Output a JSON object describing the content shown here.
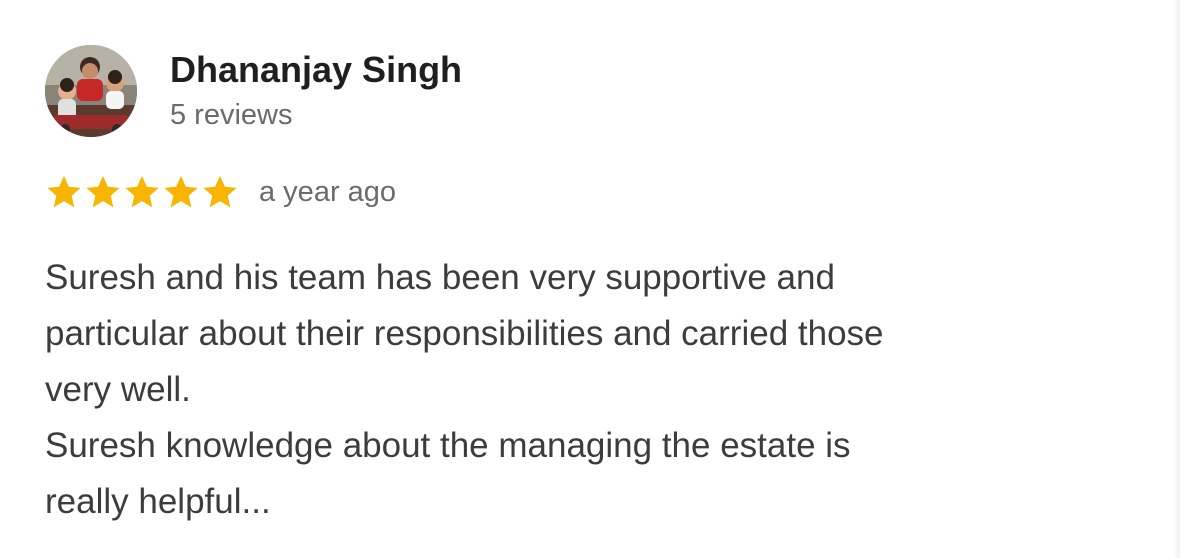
{
  "review": {
    "author": {
      "name": "Dhananjay Singh",
      "review_count": "5 reviews",
      "avatar_icon": "profile-photo"
    },
    "rating": {
      "stars": 5,
      "max": 5,
      "star_color": "#F7B500",
      "star_icon": "star-icon"
    },
    "time": "a year ago",
    "text_lines": [
      "Suresh and his team has been very supportive and",
      "particular about their responsibilities and carried those",
      "very well.",
      "Suresh knowledge about the managing the estate is",
      "really helpful..."
    ]
  }
}
